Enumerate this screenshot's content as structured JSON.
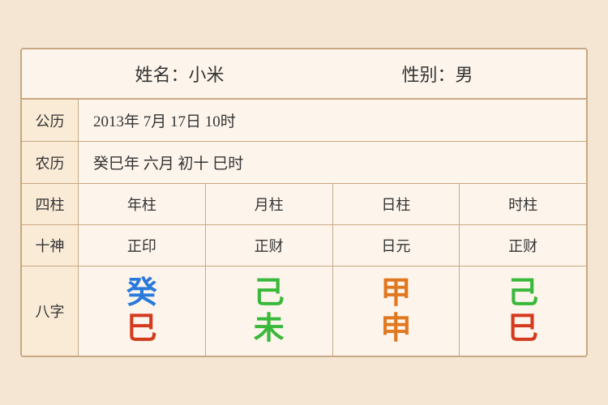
{
  "header": {
    "name_label": "姓名：小米",
    "gender_label": "性别：男"
  },
  "gregorian": {
    "label": "公历",
    "value": "2013年 7月 17日 10时"
  },
  "lunar": {
    "label": "农历",
    "value": "癸巳年 六月 初十 巳时"
  },
  "columns": {
    "label": "四柱",
    "items": [
      "年柱",
      "月柱",
      "日柱",
      "时柱"
    ]
  },
  "shishen": {
    "label": "十神",
    "items": [
      "正印",
      "正财",
      "日元",
      "正财"
    ]
  },
  "bazhi": {
    "label": "八字",
    "columns": [
      {
        "top": "癸",
        "top_color": "blue",
        "bottom": "巳",
        "bottom_color": "red"
      },
      {
        "top": "己",
        "top_color": "green",
        "bottom": "未",
        "bottom_color": "green"
      },
      {
        "top": "甲",
        "top_color": "orange",
        "bottom": "申",
        "bottom_color": "orange"
      },
      {
        "top": "己",
        "top_color": "green2",
        "bottom": "巳",
        "bottom_color": "red2"
      }
    ]
  }
}
